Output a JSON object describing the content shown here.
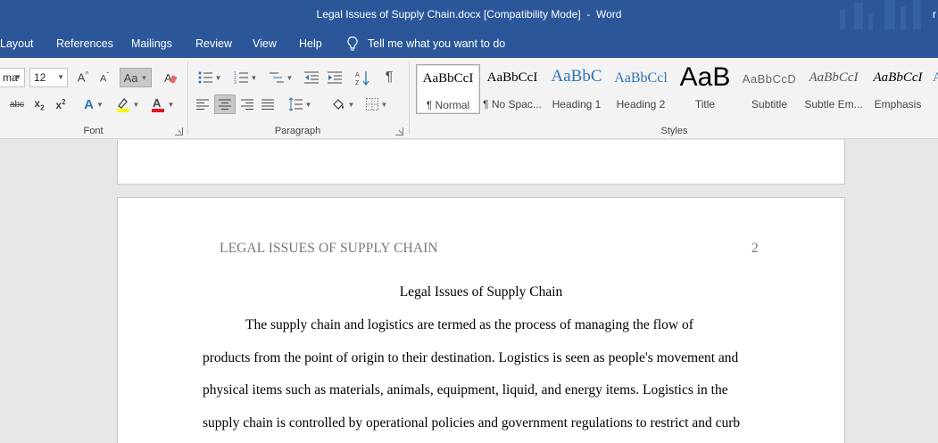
{
  "window": {
    "title": "Legal Issues of Supply Chain.docx [Compatibility Mode]  -  Word",
    "user_initial": "r"
  },
  "menu": {
    "tabs": [
      "Layout",
      "References",
      "Mailings",
      "Review",
      "View",
      "Help"
    ],
    "tell_me": "Tell me what you want to do"
  },
  "ribbon": {
    "font": {
      "name": "ma",
      "size": "12",
      "group_label": "Font",
      "change_case": "Aa"
    },
    "paragraph": {
      "group_label": "Paragraph"
    },
    "styles": {
      "group_label": "Styles",
      "items": [
        {
          "preview": "AaBbCcI",
          "name": "¶ Normal"
        },
        {
          "preview": "AaBbCcI",
          "name": "¶ No Spac..."
        },
        {
          "preview": "AaBbC",
          "name": "Heading 1"
        },
        {
          "preview": "AaBbCcl",
          "name": "Heading 2"
        },
        {
          "preview": "AaB",
          "name": "Title"
        },
        {
          "preview": "AaBbCcD",
          "name": "Subtitle"
        },
        {
          "preview": "AaBbCcI",
          "name": "Subtle Em..."
        },
        {
          "preview": "AaBbCcI",
          "name": "Emphasis"
        }
      ]
    }
  },
  "document": {
    "running_head": "LEGAL ISSUES OF SUPPLY CHAIN",
    "page_number": "2",
    "title": "Legal Issues of Supply Chain",
    "lines": [
      "The supply chain and logistics are termed as the process of managing the flow of",
      "products from the point of origin to their destination. Logistics is seen as people's movement and",
      "physical items such as materials, animals, equipment, liquid, and energy items. Logistics in the",
      "supply chain is controlled by operational policies and government regulations to restrict and curb"
    ]
  },
  "colors": {
    "titlebar": "#2b579a",
    "ribbon": "#f3f3f3",
    "canvas": "#e6e6e6",
    "heading_blue": "#2e74b5",
    "font_color_red": "#e81123",
    "highlight_yellow": "#ffff00"
  }
}
